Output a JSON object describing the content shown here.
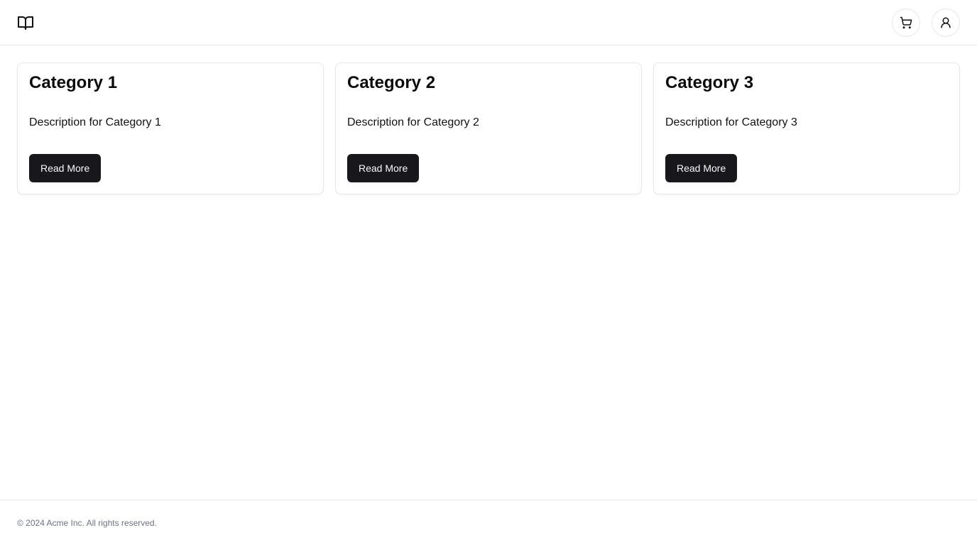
{
  "header": {
    "logo_icon": "open-book-icon",
    "cart_icon": "shopping-cart-icon",
    "user_icon": "user-icon"
  },
  "cards": [
    {
      "title": "Category 1",
      "description": "Description for Category 1",
      "button_label": "Read More"
    },
    {
      "title": "Category 2",
      "description": "Description for Category 2",
      "button_label": "Read More"
    },
    {
      "title": "Category 3",
      "description": "Description for Category 3",
      "button_label": "Read More"
    }
  ],
  "footer": {
    "copyright": "© 2024 Acme Inc. All rights reserved."
  },
  "colors": {
    "button_background": "#18181b",
    "button_text": "#fafafa",
    "border": "#e5e7eb",
    "muted_text": "#6b7280"
  }
}
